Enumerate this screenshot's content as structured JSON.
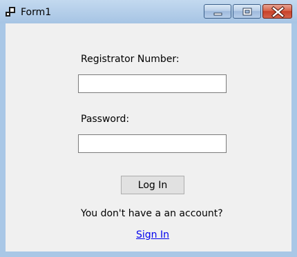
{
  "window": {
    "title": "Form1",
    "icons": {
      "app": "app-windows-icon",
      "minimize": "minimize-icon",
      "maximize": "maximize-icon",
      "close": "close-icon"
    },
    "colors": {
      "titlebar": "#a6c4e4",
      "close_button": "#c84128",
      "client_background": "#f0f0f0",
      "link": "#0000ee"
    }
  },
  "form": {
    "registrator_label": "Registrator Number:",
    "registrator_value": "",
    "password_label": "Password:",
    "password_value": "",
    "login_button": "Log In",
    "no_account_text": "You don't have a an account?",
    "signin_link": "Sign In"
  }
}
